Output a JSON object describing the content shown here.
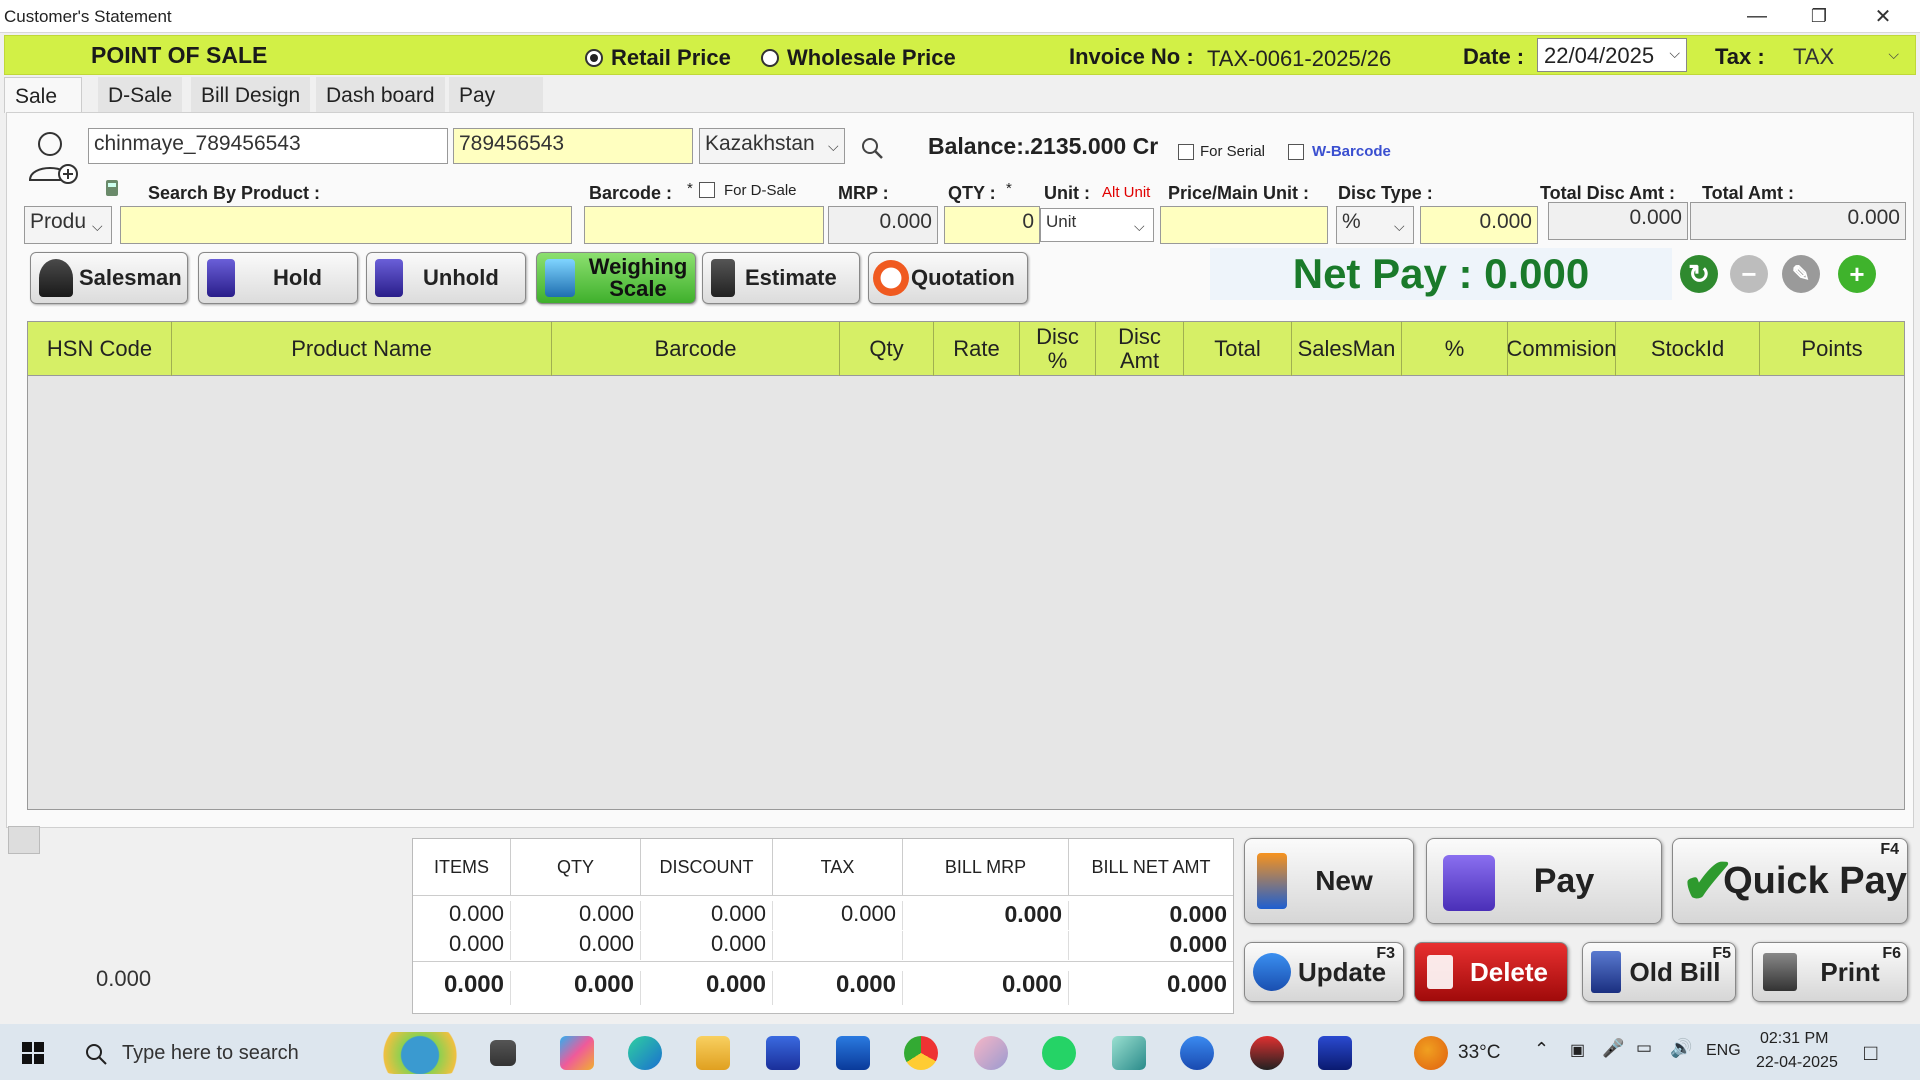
{
  "window": {
    "title": "Customer's Statement",
    "minimize": "—",
    "restore": "❐",
    "close": "✕"
  },
  "header": {
    "title": "POINT OF SALE",
    "price_mode": {
      "retail": "Retail Price",
      "wholesale": "Wholesale Price",
      "selected": "Retail Price"
    },
    "invoice_label": "Invoice No :",
    "invoice_no": "TAX-0061-2025/26",
    "date_label": "Date :",
    "date_value": "22/04/2025",
    "tax_label": "Tax :",
    "tax_value": "TAX",
    "accent_color": "#d2f046"
  },
  "tabs": [
    "Sale",
    "D-Sale",
    "Bill Design",
    "Dash board",
    "Pay"
  ],
  "customer": {
    "name": "chinmaye_789456543",
    "phone": "789456543",
    "country": "Kazakhstan",
    "balance": "Balance:.2135.000 Cr",
    "for_serial": "For Serial",
    "w_barcode": "W-Barcode"
  },
  "entry": {
    "search_by_product_label": "Search By Product :",
    "search_mode": "Produ",
    "barcode_label": "Barcode :",
    "required_mark": "*",
    "for_dsale": "For D-Sale",
    "mrp_label": "MRP :",
    "mrp_value": "0.000",
    "qty_label": "QTY :",
    "qty_value": "0",
    "unit_label": "Unit :",
    "alt_unit": "Alt Unit",
    "unit_value": "Unit",
    "price_main_unit_label": "Price/Main Unit :",
    "disc_type_label": "Disc Type :",
    "disc_type_value": "%",
    "disc_value": "0.000",
    "total_disc_amt_label": "Total Disc Amt :",
    "total_disc_amt": "0.000",
    "total_amt_label": "Total Amt :",
    "total_amt": "0.000"
  },
  "actions": {
    "salesman": "Salesman",
    "hold": "Hold",
    "unhold": "Unhold",
    "weighing_scale_line1": "Weighing",
    "weighing_scale_line2": "Scale",
    "estimate": "Estimate",
    "quotation": "Quotation"
  },
  "net_pay": "Net Pay : 0.000",
  "grid": {
    "columns": [
      "HSN Code",
      "Product Name",
      "Barcode",
      "Qty",
      "Rate",
      "Disc\n%",
      "Disc\nAmt",
      "Total",
      "SalesMan",
      "%",
      "Commision",
      "StockId",
      "Points"
    ],
    "rows": []
  },
  "left_total": "0.000",
  "summary": {
    "headers": [
      "ITEMS",
      "QTY",
      "DISCOUNT",
      "TAX",
      "BILL MRP",
      "BILL NET AMT"
    ],
    "row1": [
      "0.000",
      "0.000",
      "0.000",
      "0.000",
      "0.000",
      "0.000"
    ],
    "row2": [
      "0.000",
      "0.000",
      "0.000",
      "",
      "",
      "0.000"
    ],
    "total": [
      "0.000",
      "0.000",
      "0.000",
      "0.000",
      "0.000",
      "0.000"
    ]
  },
  "bottom_buttons": {
    "new": "New",
    "pay": "Pay",
    "quick_pay": "Quick Pay",
    "quick_pay_key": "F4",
    "update": "Update",
    "update_key": "F3",
    "delete": "Delete",
    "old_bill": "Old Bill",
    "old_bill_key": "F5",
    "print": "Print",
    "print_key": "F6"
  },
  "taskbar": {
    "search_placeholder": "Type here to search",
    "weather": "33°C",
    "language": "ENG",
    "time": "02:31 PM",
    "date": "22-04-2025"
  }
}
